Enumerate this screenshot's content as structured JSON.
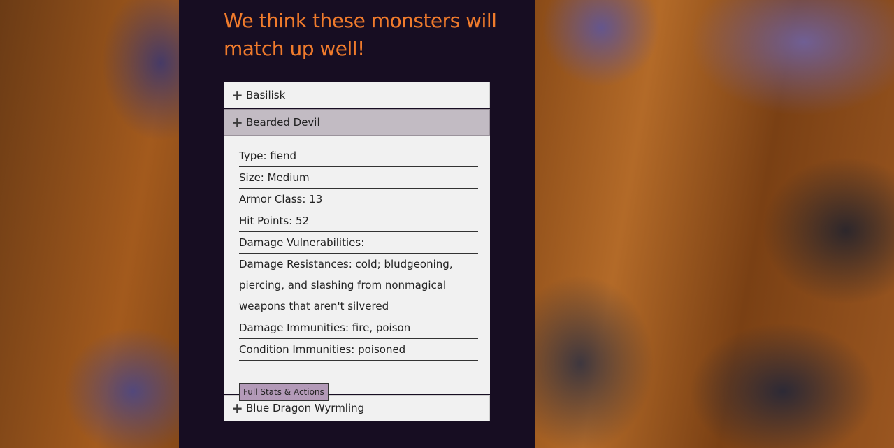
{
  "heading": "We think these monsters will match up well!",
  "accordion": {
    "items": [
      {
        "label": "Basilisk",
        "expanded": false
      },
      {
        "label": "Bearded Devil",
        "expanded": true
      },
      {
        "label": "Blue Dragon Wyrmling",
        "expanded": false
      }
    ],
    "expanded_icon": "plus-icon",
    "details": {
      "type": "Type: fiend",
      "size": "Size: Medium",
      "armor_class": "Armor Class: 13",
      "hit_points": "Hit Points: 52",
      "damage_vulnerabilities": "Damage Vulnerabilities:",
      "damage_resistances": "Damage Resistances: cold; bludgeoning, piercing, and slashing from nonmagical weapons that aren't silvered",
      "damage_immunities": "Damage Immunities: fire, poison",
      "condition_immunities": "Condition Immunities: poisoned"
    },
    "full_stats_button": "Full Stats & Actions"
  },
  "colors": {
    "heading": "#f07b2c",
    "panel": "#170d22",
    "active_header": "#c2bbc3",
    "button": "#b39ab8"
  }
}
